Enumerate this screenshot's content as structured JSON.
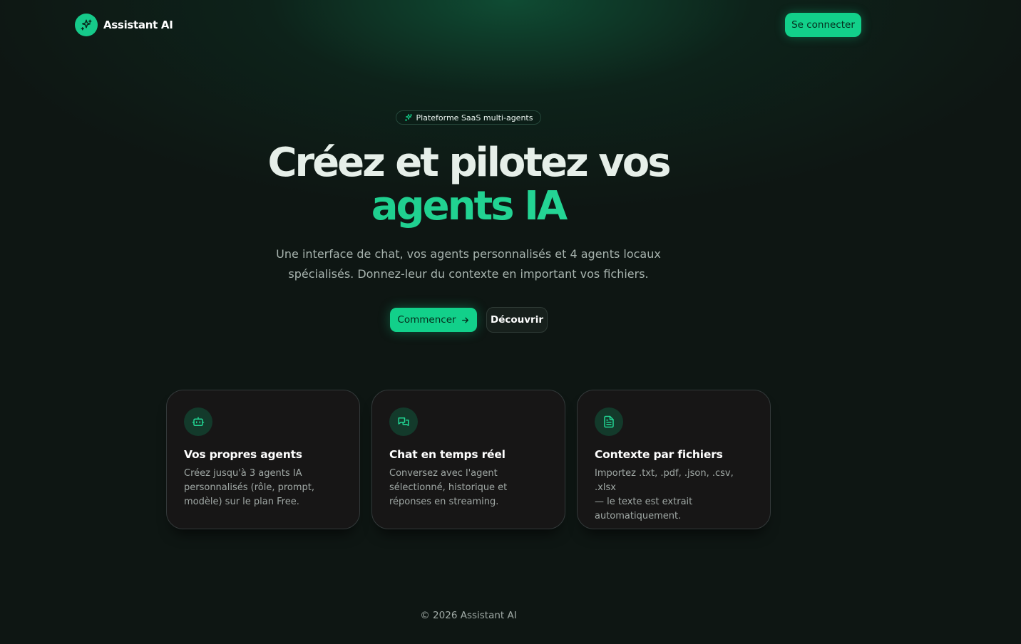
{
  "header": {
    "brand_name": "Assistant AI",
    "login_label": "Se connecter"
  },
  "hero": {
    "badge": "Plateforme SaaS multi-agents",
    "title_line1": "Créez et pilotez vos",
    "title_line2": "agents IA",
    "subtitle_line1": "Une interface de chat, vos agents personnalisés et 4 agents locaux",
    "subtitle_line2": "spécialisés. Donnez-leur du contexte en important vos fichiers.",
    "primary_cta": "Commencer",
    "secondary_cta": "Découvrir"
  },
  "features": [
    {
      "icon": "bot-icon",
      "title": "Vos propres agents",
      "desc": [
        "Créez jusqu'à 3 agents IA",
        "personnalisés (rôle, prompt,",
        "modèle) sur le plan Free."
      ]
    },
    {
      "icon": "chat-bubbles-icon",
      "title": "Chat en temps réel",
      "desc": [
        "Conversez avec l'agent",
        "sélectionné, historique et",
        "réponses en streaming."
      ]
    },
    {
      "icon": "file-text-icon",
      "title": "Contexte par fichiers",
      "desc": [
        "Importez .txt, .pdf, .json, .csv, .xlsx",
        "— le texte est extrait",
        "automatiquement."
      ]
    }
  ],
  "footer": {
    "copyright": "© 2026 Assistant AI"
  },
  "colors": {
    "accent": "#12d08a",
    "background": "#0e1613",
    "card": "#171616"
  }
}
